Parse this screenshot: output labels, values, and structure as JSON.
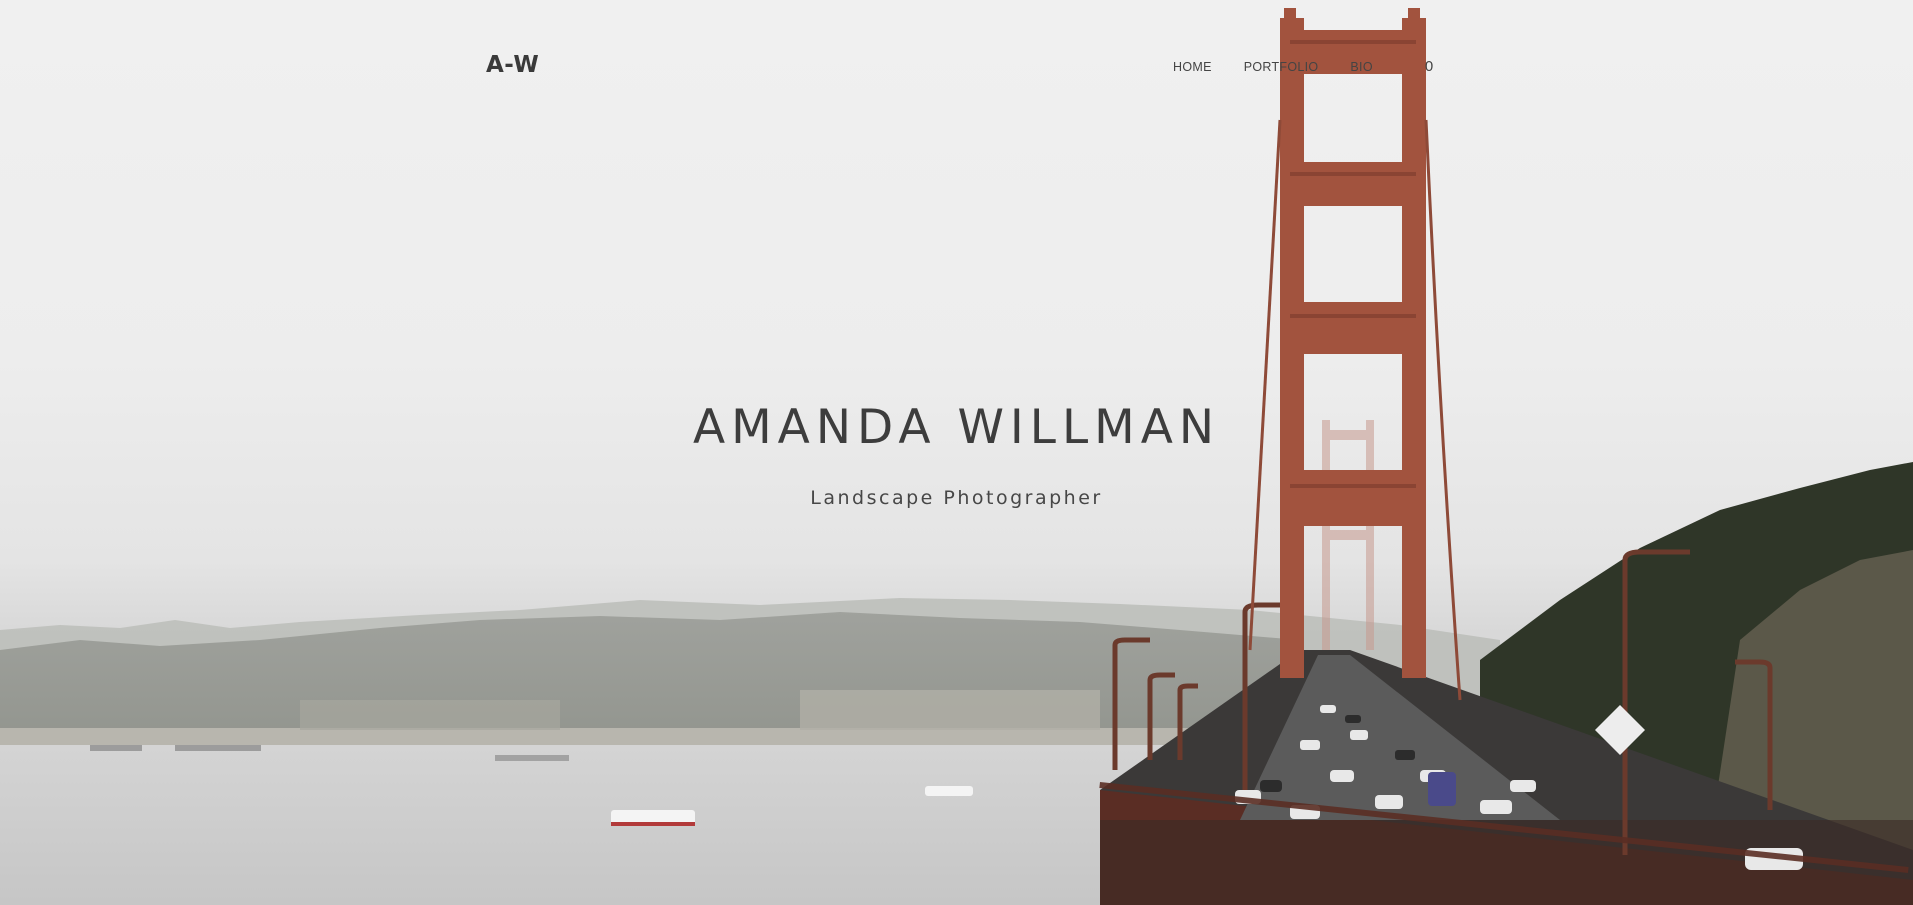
{
  "header": {
    "logo": "A-W",
    "nav": [
      {
        "label": "HOME"
      },
      {
        "label": "PORTFOLIO"
      },
      {
        "label": "BIO"
      }
    ],
    "cart_count": "0"
  },
  "hero": {
    "title": "AMANDA WILLMAN",
    "subtitle": "Landscape Photographer",
    "background_image": "golden-gate-bridge-foggy-bay-photo"
  },
  "colors": {
    "text": "#3d3d3d",
    "bridge": "#a2533e",
    "sky": "#efefef"
  }
}
